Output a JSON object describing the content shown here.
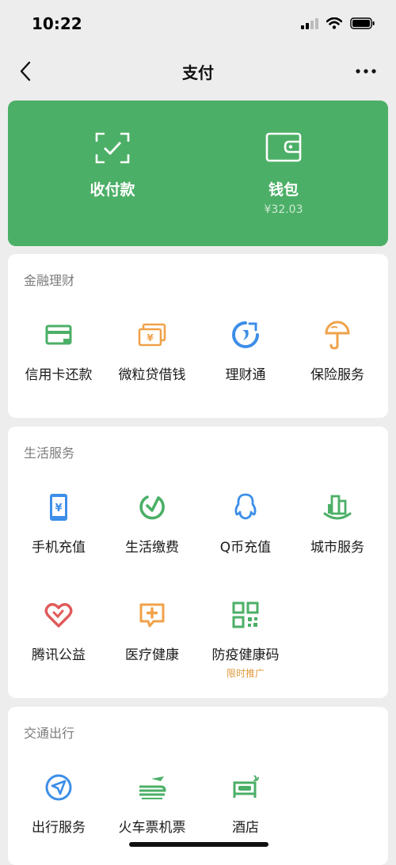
{
  "status_bar": {
    "time": "10:22"
  },
  "nav": {
    "title": "支付",
    "back_icon": "chevron-left-icon",
    "more_icon": "more-dots-icon"
  },
  "header_card": {
    "background": "#4caf67",
    "items": [
      {
        "label": "收付款",
        "icon": "scan-check-icon"
      },
      {
        "label": "钱包",
        "icon": "wallet-icon",
        "balance": "¥32.03"
      }
    ]
  },
  "sections": [
    {
      "title": "金融理财",
      "items": [
        {
          "label": "信用卡还款",
          "icon": "credit-card-icon",
          "color": "#4caf67"
        },
        {
          "label": "微粒贷借钱",
          "icon": "yuan-bill-icon",
          "color": "#f0a24a"
        },
        {
          "label": "理财通",
          "icon": "licaitong-icon",
          "color": "#3d8ee8"
        },
        {
          "label": "保险服务",
          "icon": "umbrella-shield-icon",
          "color": "#f0a24a"
        }
      ]
    },
    {
      "title": "生活服务",
      "items": [
        {
          "label": "手机充值",
          "icon": "mobile-yuan-icon",
          "color": "#3d8ee8"
        },
        {
          "label": "生活缴费",
          "icon": "check-circle-icon",
          "color": "#4caf67"
        },
        {
          "label": "Q币充值",
          "icon": "qq-penguin-icon",
          "color": "#3d8ee8"
        },
        {
          "label": "城市服务",
          "icon": "city-buildings-icon",
          "color": "#4caf67"
        },
        {
          "label": "腾讯公益",
          "icon": "heart-icon",
          "color": "#e05a5a"
        },
        {
          "label": "医疗健康",
          "icon": "medical-cross-icon",
          "color": "#f0a24a"
        },
        {
          "label": "防疫健康码",
          "icon": "qr-code-icon",
          "color": "#4caf67",
          "sub": "限时推广"
        }
      ]
    },
    {
      "title": "交通出行",
      "items": [
        {
          "label": "出行服务",
          "icon": "navigation-arrow-icon",
          "color": "#3d8ee8"
        },
        {
          "label": "火车票机票",
          "icon": "train-plane-icon",
          "color": "#4caf67"
        },
        {
          "label": "酒店",
          "icon": "hotel-bed-icon",
          "color": "#4caf67"
        }
      ]
    }
  ]
}
